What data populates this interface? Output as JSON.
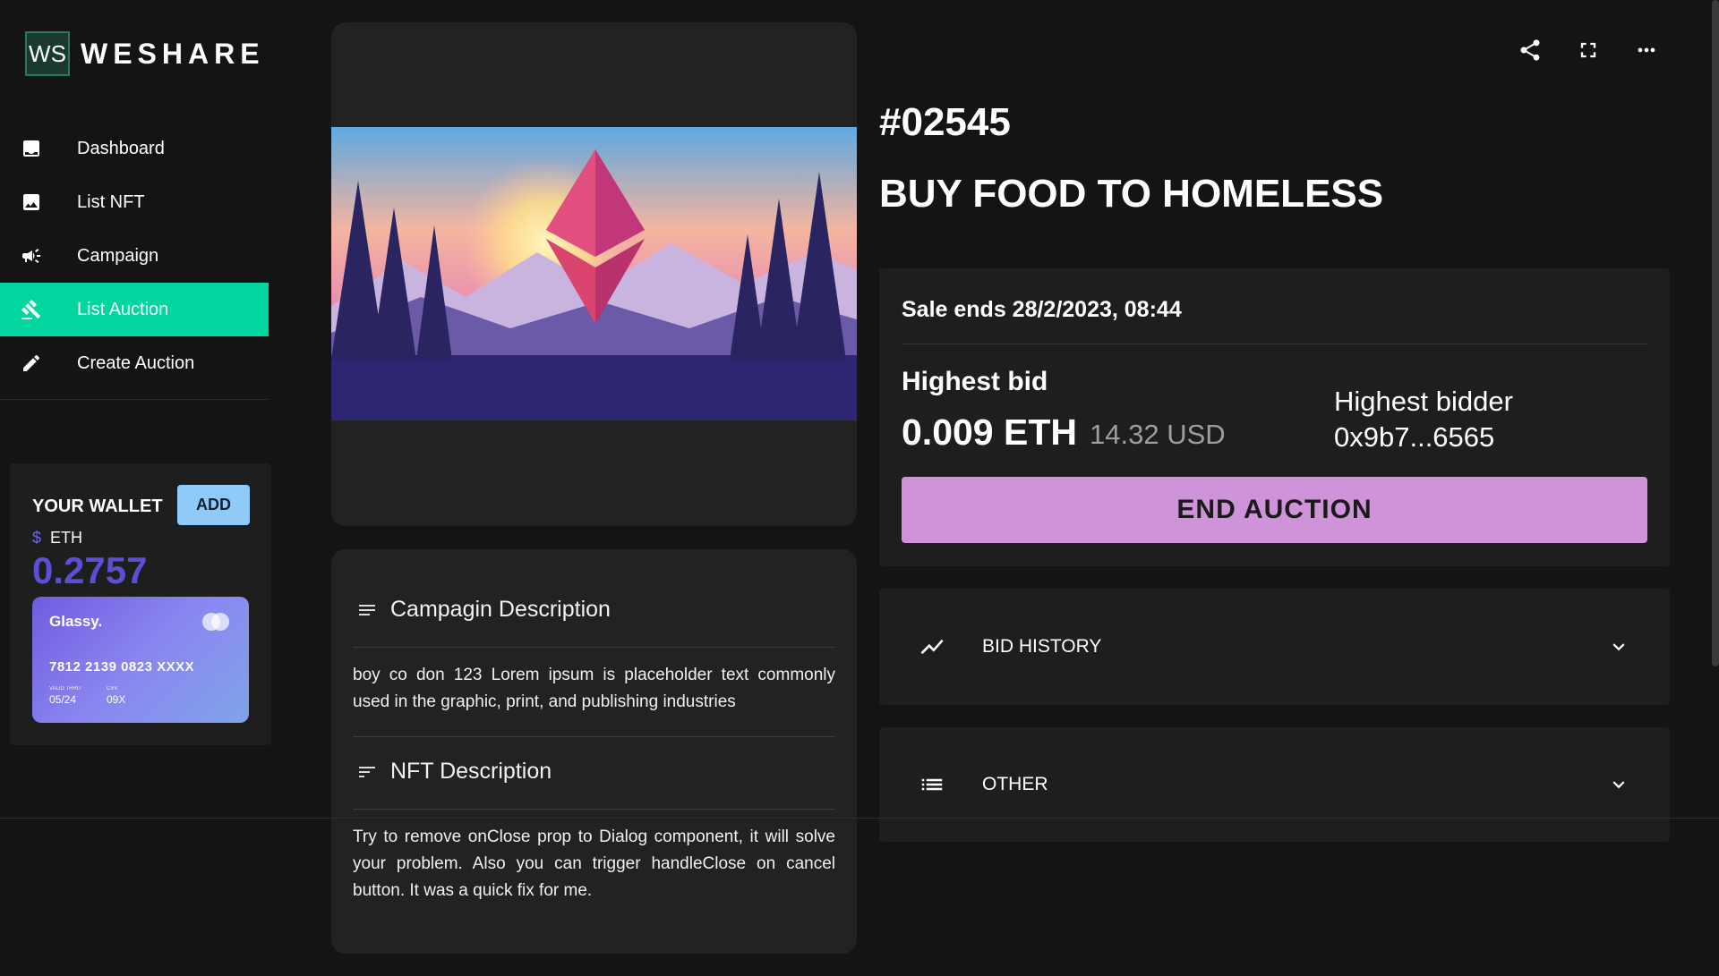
{
  "app": {
    "logo_initials": "WS",
    "logo_text": "WESHARE"
  },
  "sidebar": {
    "items": [
      {
        "label": "Dashboard",
        "icon": "dashboard-icon",
        "active": false
      },
      {
        "label": "List NFT",
        "icon": "image-icon",
        "active": false
      },
      {
        "label": "Campaign",
        "icon": "megaphone-icon",
        "active": false
      },
      {
        "label": "List Auction",
        "icon": "gavel-icon",
        "active": true
      },
      {
        "label": "Create Auction",
        "icon": "pencil-icon",
        "active": false
      }
    ]
  },
  "wallet": {
    "title": "YOUR WALLET",
    "add_label": "ADD",
    "currency_symbol": "$",
    "currency": "ETH",
    "balance": "0.2757",
    "card": {
      "brand": "Glassy.",
      "number": "7812 2139 0823 XXXX",
      "valid_label": "VALID THRU",
      "valid": "05/24",
      "cvv_label": "CVV",
      "cvv": "09X"
    }
  },
  "nft": {
    "token_id": "#02545",
    "campaign_title": "BUY FOOD TO HOMELESS"
  },
  "descriptions": {
    "campaign_heading": "Campagin Description",
    "campaign_text": "boy co don 123 Lorem ipsum is placeholder text commonly used in the graphic, print, and publishing industries",
    "nft_heading": "NFT Description",
    "nft_text": "Try to remove onClose prop to Dialog component, it will solve your problem. Also you can trigger handleClose on cancel button. It was a quick fix for me."
  },
  "auction": {
    "sale_ends": "Sale ends 28/2/2023, 08:44",
    "highest_bid_label": "Highest bid",
    "highest_bid_eth": "0.009 ETH",
    "highest_bid_usd": "14.32 USD",
    "highest_bidder_label": "Highest bidder",
    "highest_bidder": "0x9b7...6565",
    "end_button": "END AUCTION"
  },
  "accordions": {
    "bid_history": "BID HISTORY",
    "other": "OTHER"
  },
  "colors": {
    "accent_active": "#00d69e",
    "end_button": "#ce93d8",
    "add_button": "#90caf9",
    "balance": "#5b4fd6"
  }
}
